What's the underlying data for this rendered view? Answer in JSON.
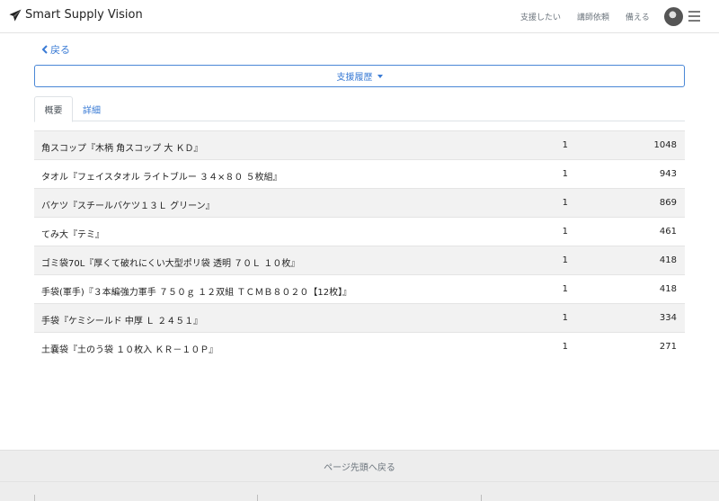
{
  "header": {
    "brand": "Smart Supply Vision",
    "nav": [
      "支援したい",
      "講師依頼",
      "備える"
    ]
  },
  "back_label": "戻る",
  "dropdown_label": "支援履歴",
  "tabs": [
    "概要",
    "詳細"
  ],
  "rows": [
    {
      "name": "角スコップ『木柄 角スコップ 大 ＫＤ』",
      "qty": "1",
      "count": "1048"
    },
    {
      "name": "タオル『フェイスタオル ライトブルー ３４×８０ ５枚組』",
      "qty": "1",
      "count": "943"
    },
    {
      "name": "バケツ『スチールバケツ１３Ｌ グリーン』",
      "qty": "1",
      "count": "869"
    },
    {
      "name": "てみ大『テミ』",
      "qty": "1",
      "count": "461"
    },
    {
      "name": "ゴミ袋70L『厚くて破れにくい大型ポリ袋 透明 ７０Ｌ １０枚』",
      "qty": "1",
      "count": "418"
    },
    {
      "name": "手袋(軍手)『３本編強力軍手 ７５０ｇ １２双組 ＴＣＭＢ８０２０【12枚】』",
      "qty": "1",
      "count": "418"
    },
    {
      "name": "手袋『ケミシールド 中厚 Ｌ ２４５１』",
      "qty": "1",
      "count": "334"
    },
    {
      "name": "土嚢袋『土のう袋 １０枚入 ＫＲ－１０Ｐ』",
      "qty": "1",
      "count": "271"
    }
  ],
  "page_top_label": "ページ先頭へ戻る",
  "colors": {
    "accent": "#3a7bd5",
    "stripe": "#f2f2f2",
    "footer": "#ededed"
  }
}
